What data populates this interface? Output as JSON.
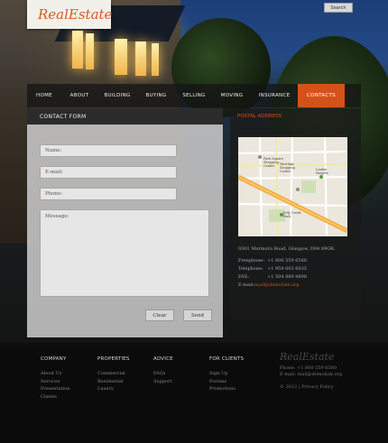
{
  "header": {
    "logo_text": "RealEstate",
    "search_label": "Search"
  },
  "nav": {
    "items": [
      {
        "label": "HOME"
      },
      {
        "label": "ABOUT"
      },
      {
        "label": "BUYING"
      },
      {
        "label": "BUYING"
      },
      {
        "label": "SELLING"
      },
      {
        "label": "MOVING"
      },
      {
        "label": "INSURANCE"
      },
      {
        "label": "CONTACTS",
        "active": true
      }
    ]
  },
  "contact_form": {
    "title": "CONTACT FORM",
    "name_placeholder": "Name:",
    "email_placeholder": "E-mail:",
    "phone_placeholder": "Phone:",
    "message_placeholder": "Message:",
    "clear_label": "Clear",
    "send_label": "Send"
  },
  "postal": {
    "title": "POSTAL ADDRESS",
    "address": "0301 Marmora Road, Glasgow, D04 89GR.",
    "rows": [
      {
        "label": "Freephone:",
        "value": "+1 800 559 6580"
      },
      {
        "label": "Telephone:",
        "value": "+1 959 603 6035"
      },
      {
        "label": "FAX:",
        "value": "+1 504 889 9898"
      }
    ],
    "email_label": "E-mail:",
    "email_value": "mail@demolink.org",
    "map_labels": [
      "Park Square Shopping Center",
      "Westlake Shopping Center",
      "Jelly Creek Park",
      "Linden Heights"
    ]
  },
  "footer": {
    "columns": [
      {
        "heading": "COMPANY",
        "items": [
          "About Us",
          "Services",
          "Presentation",
          "Clients"
        ]
      },
      {
        "heading": "PROPERTIES",
        "items": [
          "Commercial",
          "Residential",
          "Luxury"
        ]
      },
      {
        "heading": "ADVICE",
        "items": [
          "FAQs",
          "Support"
        ]
      },
      {
        "heading": "FOR CLIENTS",
        "items": [
          "Sign Up",
          "Forums",
          "Promotions"
        ]
      }
    ],
    "logo_text": "RealEstate",
    "phone": "Phone: +1 800 559 6580",
    "email": "E-mail: mail@demolink.org",
    "copyright": "© 2012 | Privacy Policy"
  },
  "colors": {
    "accent": "#d4521a",
    "nav_bg": "#1a1a1a",
    "panel_bg": "#c8c8c8"
  }
}
